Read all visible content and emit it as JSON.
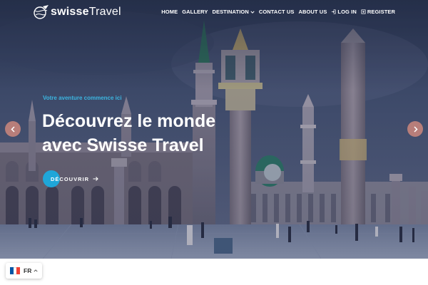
{
  "brand": {
    "name_bold": "swisse",
    "name_light": "Travel",
    "logo_icon": "globe-plane-icon"
  },
  "nav": {
    "items": [
      {
        "label": "HOME"
      },
      {
        "label": "GALLERY"
      },
      {
        "label": "DESTINATION",
        "icon": "chevron-down-icon"
      },
      {
        "label": "CONTACT US"
      },
      {
        "label": "ABOUT US"
      },
      {
        "label": "LOG IN",
        "icon": "login-icon"
      },
      {
        "label": "REGISTER",
        "icon": "register-icon"
      }
    ]
  },
  "hero": {
    "kicker": "Votre aventure commence ici",
    "headline_line1": "Découvrez le monde",
    "headline_line2": "avec Swisse Travel",
    "cta_label": "DÉCOUVRIR",
    "cta_icon": "arrow-right-icon",
    "prev_icon": "chevron-left-icon",
    "next_icon": "chevron-right-icon"
  },
  "language": {
    "code": "FR",
    "flag": "france-flag-icon",
    "caret": "chevron-up-icon",
    "flag_colors": [
      "#0055a4",
      "#ffffff",
      "#ef4135"
    ]
  },
  "colors": {
    "accent": "#1fa6d9",
    "kicker": "#3cb5e0",
    "slider_button": "#cd877d"
  }
}
